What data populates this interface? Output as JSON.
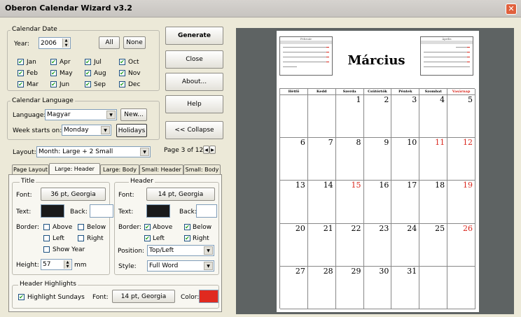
{
  "window": {
    "title": "Oberon Calendar Wizard v3.2",
    "close_glyph": "✕"
  },
  "calendar_date": {
    "group_label": "Calendar Date",
    "year_label": "Year:",
    "year_value": "2006",
    "all_label": "All",
    "none_label": "None",
    "months": [
      {
        "label": "Jan",
        "checked": true
      },
      {
        "label": "Apr",
        "checked": true
      },
      {
        "label": "Jul",
        "checked": true
      },
      {
        "label": "Oct",
        "checked": true
      },
      {
        "label": "Feb",
        "checked": true
      },
      {
        "label": "May",
        "checked": true
      },
      {
        "label": "Aug",
        "checked": true
      },
      {
        "label": "Nov",
        "checked": true
      },
      {
        "label": "Mar",
        "checked": true
      },
      {
        "label": "Jun",
        "checked": true
      },
      {
        "label": "Sep",
        "checked": true
      },
      {
        "label": "Dec",
        "checked": true
      }
    ]
  },
  "side_buttons": {
    "generate": "Generate",
    "close": "Close",
    "about": "About...",
    "help": "Help",
    "collapse": "<< Collapse",
    "page_indicator": "Page 3 of 12"
  },
  "calendar_language": {
    "group_label": "Calendar Language",
    "language_label": "Language:",
    "language_value": "Magyar",
    "new_label": "New...",
    "week_starts_label": "Week starts on:",
    "week_starts_value": "Monday",
    "holidays_label": "Holidays"
  },
  "layout": {
    "label": "Layout:",
    "value": "Month: Large + 2 Small"
  },
  "tabs": [
    {
      "label": "Page Layout",
      "active": false
    },
    {
      "label": "Large: Header",
      "active": true
    },
    {
      "label": "Large: Body",
      "active": false
    },
    {
      "label": "Small: Header",
      "active": false
    },
    {
      "label": "Small: Body",
      "active": false
    }
  ],
  "title_group": {
    "label": "Title",
    "font_label": "Font:",
    "font_value": "36 pt, Georgia",
    "text_label": "Text:",
    "back_label": "Back:",
    "text_color": "#1a1a1a",
    "back_color": "#ffffff",
    "border_label": "Border:",
    "above": "Above",
    "below": "Below",
    "left": "Left",
    "right": "Right",
    "show_year": "Show Year",
    "height_label": "Height:",
    "height_value": "57",
    "height_unit": "mm"
  },
  "header_group": {
    "label": "Header",
    "font_label": "Font:",
    "font_value": "14 pt, Georgia",
    "text_label": "Text:",
    "back_label": "Back:",
    "text_color": "#1a1a1a",
    "back_color": "#ffffff",
    "border_label": "Border:",
    "above": "Above",
    "below": "Below",
    "left": "Left",
    "right": "Right",
    "position_label": "Position:",
    "position_value": "Top/Left",
    "style_label": "Style:",
    "style_value": "Full Word"
  },
  "header_highlights": {
    "label": "Header Highlights",
    "highlight_label": "Highlight Sundays",
    "font_label": "Font:",
    "font_value": "14 pt, Georgia",
    "color_label": "Color:",
    "color": "#e02a1f"
  },
  "preview": {
    "month_title": "Március",
    "prev_month": "Február",
    "next_month": "Április",
    "weekdays": [
      "Hétfő",
      "Kedd",
      "Szerda",
      "Csütörtök",
      "Péntek",
      "Szombat",
      "Vasárnap"
    ],
    "weeks": [
      [
        "",
        "",
        "1",
        "2",
        "3",
        "4",
        "5"
      ],
      [
        "6",
        "7",
        "8",
        "9",
        "10",
        "11",
        "12"
      ],
      [
        "13",
        "14",
        "15",
        "16",
        "17",
        "18",
        "19"
      ],
      [
        "20",
        "21",
        "22",
        "23",
        "24",
        "25",
        "26"
      ],
      [
        "27",
        "28",
        "29",
        "30",
        "31",
        "",
        ""
      ]
    ],
    "sunday_color": "#d9261c",
    "holiday_color": "#d9261c"
  }
}
